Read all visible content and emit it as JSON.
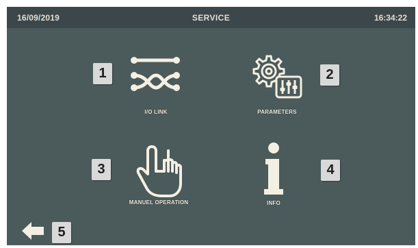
{
  "header": {
    "date": "16/09/2019",
    "title": "SERVICE",
    "time": "16:34:22"
  },
  "tiles": [
    {
      "label": "I/O LINK",
      "icon": "io-link-icon",
      "badge": "1"
    },
    {
      "label": "PARAMETERS",
      "icon": "parameters-icon",
      "badge": "2"
    },
    {
      "label": "MANUEL OPERATION",
      "icon": "hand-pointer-icon",
      "badge": "3"
    },
    {
      "label": "INFO",
      "icon": "info-icon",
      "badge": "4"
    }
  ],
  "back": {
    "icon": "arrow-left-icon",
    "badge": "5"
  },
  "colors": {
    "screen_bg": "#4b5a5b",
    "topbar_bg": "#3b474a",
    "icon": "#f3efe2",
    "badge_bg": "#d9d9d9"
  }
}
